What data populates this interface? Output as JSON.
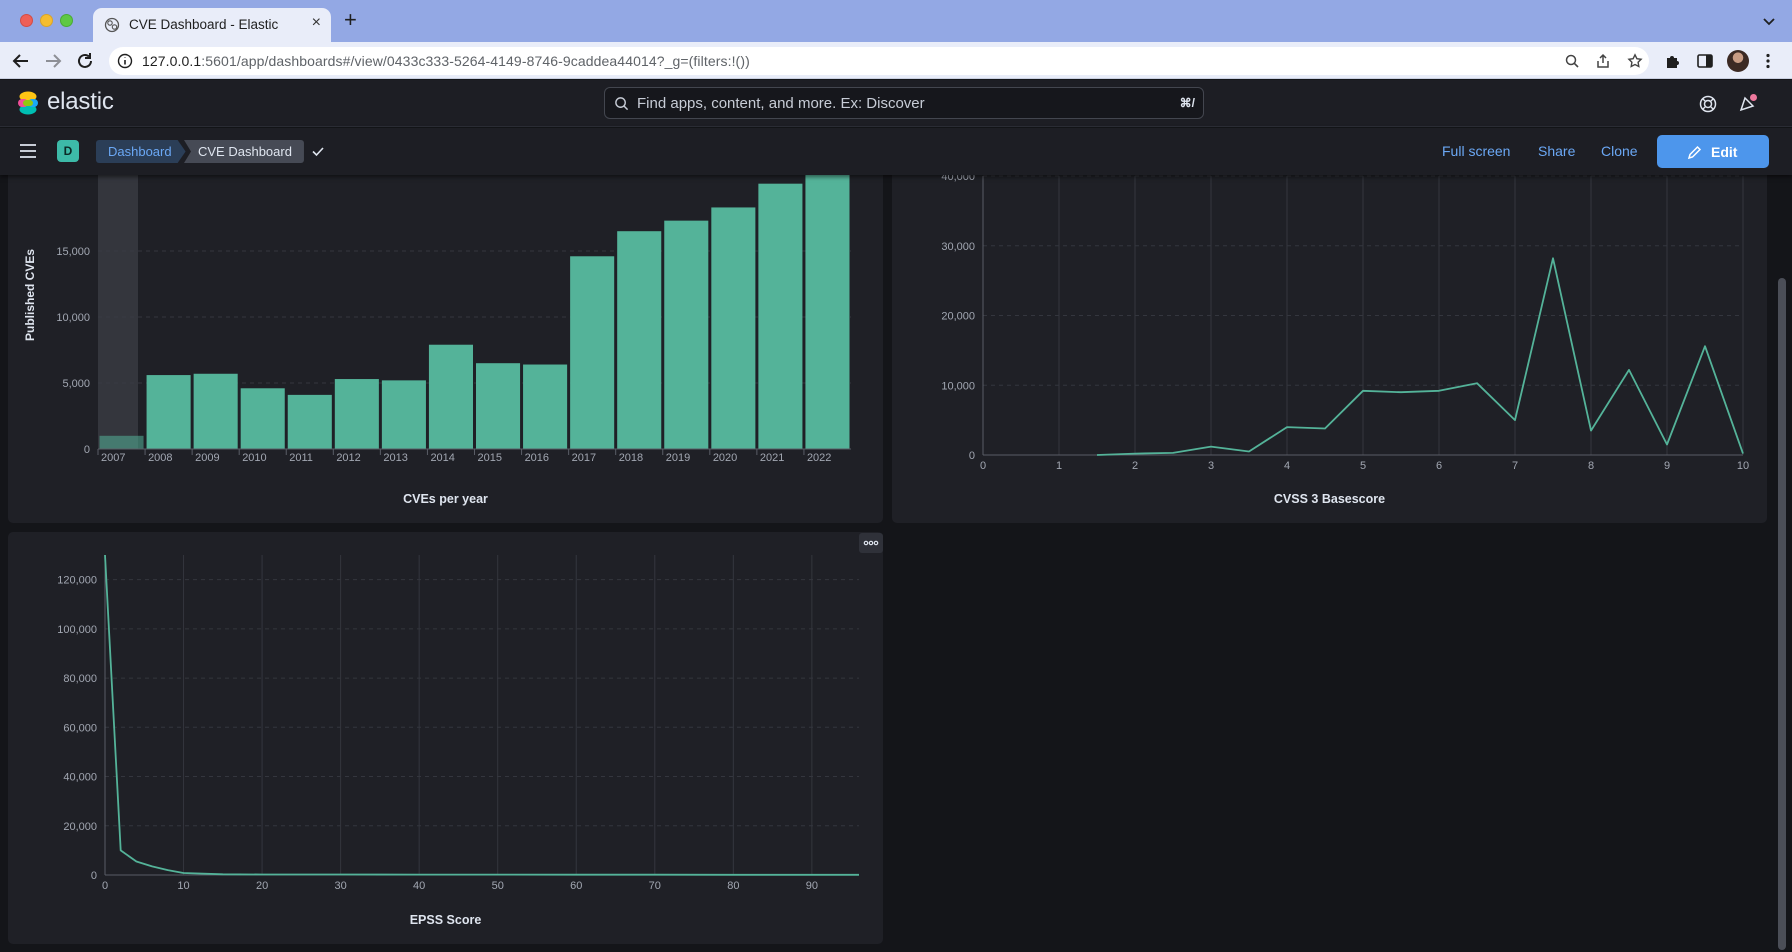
{
  "browser": {
    "tab_title": "CVE Dashboard - Elastic",
    "url_host": "127.0.0.1",
    "url_rest": ":5601/app/dashboards#/view/0433c333-5264-4149-8746-9caddea44014?_g=(filters:!())"
  },
  "kibana": {
    "brand": "elastic",
    "search_placeholder": "Find apps, content, and more. Ex: Discover",
    "search_shortcut": "⌘/",
    "space_initial": "D",
    "breadcrumbs": [
      "Dashboard",
      "CVE Dashboard"
    ],
    "actions": {
      "full_screen": "Full screen",
      "share": "Share",
      "clone": "Clone",
      "edit": "Edit"
    }
  },
  "colors": {
    "series": "#54b399",
    "accent": "#4d96ec",
    "background": "#141519",
    "panel": "#1f2026"
  },
  "chart_data": [
    {
      "type": "bar",
      "title": "CVEs per year",
      "ylabel": "Published CVEs",
      "categories": [
        "2007",
        "2008",
        "2009",
        "2010",
        "2011",
        "2012",
        "2013",
        "2014",
        "2015",
        "2016",
        "2017",
        "2018",
        "2019",
        "2020",
        "2021",
        "2022"
      ],
      "values": [
        1000,
        5600,
        5700,
        4600,
        4100,
        5300,
        5200,
        7900,
        6500,
        6400,
        14600,
        16500,
        17300,
        18300,
        20100,
        21900
      ],
      "y_ticks": [
        "0",
        "5,000",
        "10,000",
        "15,000"
      ],
      "ylim": [
        0,
        18000
      ],
      "grid": true
    },
    {
      "type": "line",
      "title": "CVSS 3 Basescore",
      "x": [
        1.5,
        2,
        2.5,
        3,
        3.5,
        4,
        4.5,
        5,
        5.5,
        6,
        6.5,
        7,
        7.5,
        8,
        8.5,
        9,
        9.5,
        10
      ],
      "y": [
        0,
        200,
        300,
        1200,
        500,
        4000,
        3800,
        9200,
        9000,
        9200,
        10300,
        5000,
        28200,
        3500,
        12200,
        1500,
        15600,
        200
      ],
      "x_ticks": [
        "0",
        "1",
        "2",
        "3",
        "4",
        "5",
        "6",
        "7",
        "8",
        "9",
        "10"
      ],
      "y_ticks": [
        "0",
        "10,000",
        "20,000",
        "30,000",
        "40,000"
      ],
      "xlim": [
        0,
        10
      ],
      "ylim": [
        0,
        40000
      ],
      "grid": true
    },
    {
      "type": "line",
      "title": "EPSS Score",
      "x": [
        0,
        2,
        4,
        6,
        8,
        10,
        15,
        20,
        30,
        40,
        50,
        60,
        70,
        80,
        90,
        96
      ],
      "y": [
        130000,
        10000,
        5500,
        3500,
        2000,
        800,
        300,
        200,
        200,
        150,
        150,
        120,
        120,
        100,
        100,
        100
      ],
      "x_ticks": [
        "0",
        "10",
        "20",
        "30",
        "40",
        "50",
        "60",
        "70",
        "80",
        "90"
      ],
      "y_ticks": [
        "0",
        "20,000",
        "40,000",
        "60,000",
        "80,000",
        "100,000",
        "120,000"
      ],
      "xlim": [
        0,
        96
      ],
      "ylim": [
        0,
        130000
      ],
      "grid": true
    }
  ]
}
